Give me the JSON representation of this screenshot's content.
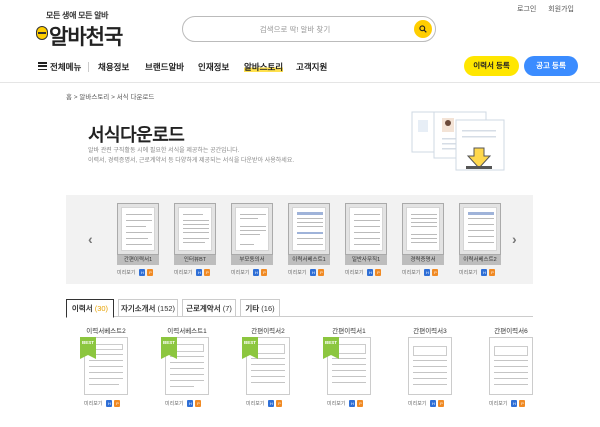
{
  "header": {
    "logo_tagline": "모든 생애 모든 알바",
    "logo_name": "알바천국",
    "search_placeholder": "검색으로 딱! 알바 찾기",
    "login": "로그인",
    "signup": "회원가입"
  },
  "nav": {
    "all_menu": "전체메뉴",
    "items": [
      "채용정보",
      "브랜드알바",
      "인재정보",
      "알바스토리",
      "고객지원"
    ],
    "active": "알바스토리",
    "resume_button": "이력서 등록",
    "post_button": "공고 등록"
  },
  "breadcrumb": "홈 > 알바스토리 > 서식 다운로드",
  "hero": {
    "title": "서식다운로드",
    "desc_line1": "알바 관련 구직활동 시에 필요한 서식을 제공하는 공간입니다.",
    "desc_line2": "이력서, 경력증명서, 근로계약서 등 다양하게 제공되는 서식을 다운받아 사용하세요."
  },
  "carousel": {
    "prev": "‹",
    "next": "›",
    "items": [
      {
        "label": "간편이력서1",
        "preview": "미리보기"
      },
      {
        "label": "인터뷰BT",
        "preview": "미리보기"
      },
      {
        "label": "부모동의서",
        "preview": "미리보기"
      },
      {
        "label": "이력서베스트1",
        "preview": "미리보기"
      },
      {
        "label": "일반사무직1",
        "preview": "미리보기"
      },
      {
        "label": "경력증명서",
        "preview": "미리보기"
      },
      {
        "label": "이력서베스트2",
        "preview": "미리보기"
      }
    ]
  },
  "tabs": [
    {
      "label": "이력서",
      "count": "(30)"
    },
    {
      "label": "자기소개서",
      "count": "(152)"
    },
    {
      "label": "근로계약서",
      "count": "(7)"
    },
    {
      "label": "기타",
      "count": "(16)"
    }
  ],
  "grid": [
    {
      "title": "이력서베스트2",
      "best": "BEST",
      "preview": "미리보기"
    },
    {
      "title": "이력서베스트1",
      "best": "BEST",
      "preview": "미리보기"
    },
    {
      "title": "간편이력서2",
      "best": "BEST",
      "preview": "미리보기"
    },
    {
      "title": "간편이력서1",
      "best": "BEST",
      "preview": "미리보기"
    },
    {
      "title": "간편이력서3",
      "best": "",
      "preview": "미리보기"
    },
    {
      "title": "간편이력서6",
      "best": "",
      "preview": "미리보기"
    }
  ],
  "file_badges": {
    "hwp": "H",
    "pdf": "P"
  },
  "colors": {
    "brand_yellow": "#ffe600",
    "post_blue": "#3b8cff",
    "best_green": "#8cc63f"
  }
}
